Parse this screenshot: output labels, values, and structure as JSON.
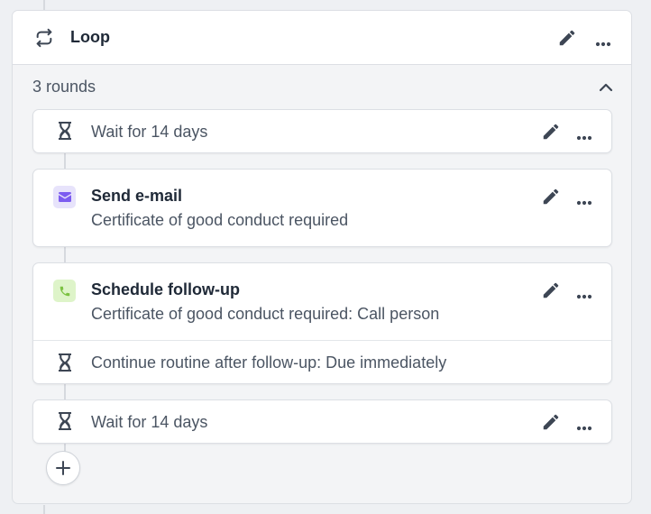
{
  "loop": {
    "title": "Loop",
    "rounds_label": "3 rounds"
  },
  "steps": {
    "wait_1": {
      "text": "Wait for 14 days"
    },
    "email": {
      "title": "Send e-mail",
      "subtitle": "Certificate of good conduct required"
    },
    "follow_up": {
      "title": "Schedule follow-up",
      "subtitle": "Certificate of good conduct required: Call person",
      "continue_text": "Continue routine after follow-up: Due immediately"
    },
    "wait_2": {
      "text": "Wait for 14 days"
    }
  },
  "colors": {
    "email_badge_bg": "#e7e3fb",
    "email_icon": "#7c5cf0",
    "phone_badge_bg": "#def4c9",
    "phone_icon": "#7cc242",
    "icon_dark": "#3d4654"
  },
  "icons": [
    "loop-icon",
    "edit-icon",
    "more-icon",
    "chevron-up-icon",
    "hourglass-icon",
    "mail-icon",
    "phone-icon",
    "plus-icon"
  ]
}
